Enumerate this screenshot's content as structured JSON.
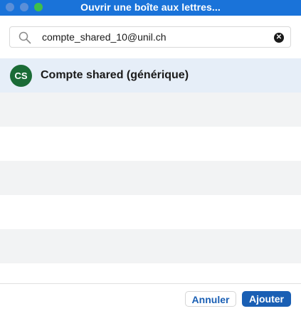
{
  "window": {
    "title": "Ouvrir une boîte aux lettres..."
  },
  "search": {
    "value": "compte_shared_10@unil.ch",
    "icon": "search-icon",
    "clear_icon": "clear-icon"
  },
  "results": {
    "items": [
      {
        "initials": "CS",
        "name": "Compte shared (générique)",
        "avatar_color": "#1b6b36",
        "selected": true
      }
    ]
  },
  "footer": {
    "cancel_label": "Annuler",
    "add_label": "Ajouter"
  },
  "colors": {
    "titlebar": "#1a73d9",
    "accent": "#1a5fb4",
    "selected_row": "#e6eef8",
    "alt_row": "#f2f3f4"
  }
}
